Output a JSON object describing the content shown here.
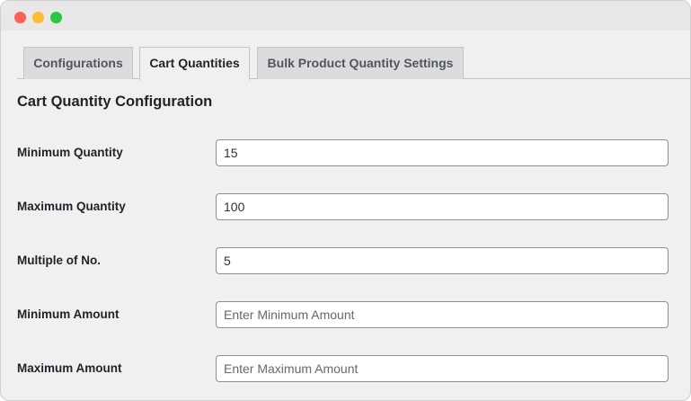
{
  "window": {
    "controls": {
      "close_color": "#ff5f57",
      "minimize_color": "#febc2e",
      "zoom_color": "#28c840"
    }
  },
  "tabs": [
    {
      "label": "Configurations",
      "active": false
    },
    {
      "label": "Cart Quantities",
      "active": true
    },
    {
      "label": "Bulk Product Quantity Settings",
      "active": false
    }
  ],
  "section_title": "Cart Quantity Configuration",
  "fields": [
    {
      "label": "Minimum Quantity",
      "value": "15",
      "placeholder": ""
    },
    {
      "label": "Maximum Quantity",
      "value": "100",
      "placeholder": ""
    },
    {
      "label": "Multiple of No.",
      "value": "5",
      "placeholder": ""
    },
    {
      "label": "Minimum Amount",
      "value": "",
      "placeholder": "Enter Minimum Amount"
    },
    {
      "label": "Maximum Amount",
      "value": "",
      "placeholder": "Enter Maximum Amount"
    }
  ]
}
